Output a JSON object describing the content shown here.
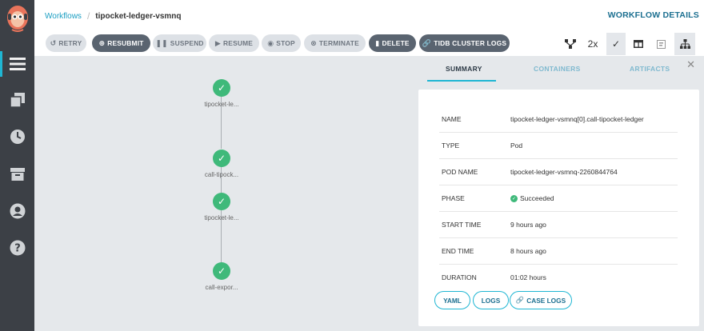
{
  "breadcrumb": {
    "root": "Workflows",
    "separator": "/",
    "current": "tipocket-ledger-vsmnq"
  },
  "header": {
    "details_label": "WORKFLOW DETAILS"
  },
  "toolbar": {
    "buttons": [
      {
        "label": "RETRY",
        "icon": "retry-icon"
      },
      {
        "label": "RESUBMIT",
        "icon": "plus-circle-icon"
      },
      {
        "label": "SUSPEND",
        "icon": "pause-icon"
      },
      {
        "label": "RESUME",
        "icon": "play-icon"
      },
      {
        "label": "STOP",
        "icon": "stop-circle-icon"
      },
      {
        "label": "TERMINATE",
        "icon": "x-circle-icon"
      },
      {
        "label": "DELETE",
        "icon": "trash-icon"
      },
      {
        "label": "TIDB CLUSTER LOGS",
        "icon": "link-icon"
      }
    ],
    "zoom": "2x"
  },
  "graph": {
    "nodes": [
      {
        "label": "tipocket-le...",
        "status": "succeeded"
      },
      {
        "label": "call-tipock...",
        "status": "succeeded"
      },
      {
        "label": "tipocket-le...",
        "status": "succeeded"
      },
      {
        "label": "call-expor...",
        "status": "succeeded"
      }
    ]
  },
  "panel": {
    "tabs": [
      "SUMMARY",
      "CONTAINERS",
      "ARTIFACTS"
    ],
    "active_tab": "SUMMARY",
    "fields": [
      {
        "key": "NAME",
        "value": "tipocket-ledger-vsmnq[0].call-tipocket-ledger"
      },
      {
        "key": "TYPE",
        "value": "Pod"
      },
      {
        "key": "POD NAME",
        "value": "tipocket-ledger-vsmnq-2260844764"
      },
      {
        "key": "PHASE",
        "value": "Succeeded"
      },
      {
        "key": "START TIME",
        "value": "9 hours ago"
      },
      {
        "key": "END TIME",
        "value": "8 hours ago"
      },
      {
        "key": "DURATION",
        "value": "01:02 hours"
      }
    ],
    "actions": [
      "YAML",
      "LOGS",
      "CASE LOGS"
    ]
  },
  "colors": {
    "accent": "#1fb6d3",
    "success": "#3fb97a",
    "rail": "#3c4046",
    "dark_button": "#5a6470"
  }
}
